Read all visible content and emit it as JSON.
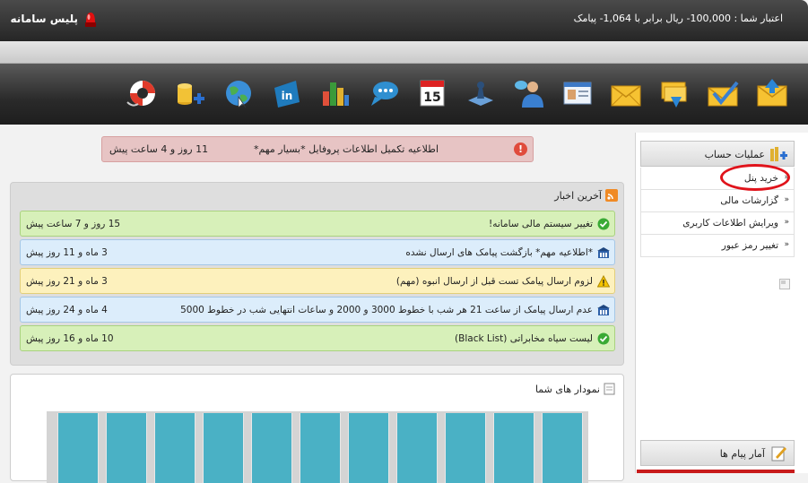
{
  "header": {
    "brand": "پلیس سامانه",
    "credit": "اعتبار شما : 100,000- ریال برابر با 1,064- پیامک"
  },
  "toolbar": {
    "icons": [
      "envelope-up-icon",
      "envelope-check-icon",
      "envelope-stack-icon",
      "envelope-open-icon",
      "id-card-icon",
      "contacts-icon",
      "chess-piece-icon",
      "calendar-icon",
      "chat-icon",
      "bar-chart-icon",
      "linkedin-icon",
      "globe-icon",
      "coins-add-icon",
      "lifebuoy-icon"
    ],
    "calendar_day": "15"
  },
  "alert": {
    "message": "اطلاعیه تکمیل اطلاعات پروفایل *بسیار مهم*",
    "time": "11 روز و 4 ساعت پیش"
  },
  "news": {
    "title": "آخرین اخبار",
    "items": [
      {
        "type": "green",
        "icon": "check",
        "text": "تغییر سیستم مالی سامانه!",
        "time": "15 روز و 7 ساعت پیش"
      },
      {
        "type": "blue",
        "icon": "info",
        "text": "*اطلاعیه مهم* بازگشت پیامک های ارسال نشده",
        "time": "3 ماه و 11 روز پیش"
      },
      {
        "type": "yellow",
        "icon": "warning",
        "text": "لزوم ارسال پیامک تست قبل از ارسال انبوه (مهم)",
        "time": "3 ماه و 21 روز پیش"
      },
      {
        "type": "blue",
        "icon": "info",
        "text": "عدم ارسال پیامک از ساعت 21 هر شب با خطوط 3000 و 2000 و ساعات انتهایی شب در خطوط 5000",
        "time": "4 ماه و 24 روز پیش"
      },
      {
        "type": "green",
        "icon": "check",
        "text": "لیست سیاه مخابراتی (Black List)",
        "time": "10 ماه و 16 روز پیش"
      }
    ]
  },
  "chart": {
    "title": "نمودار های شما"
  },
  "sidebar": {
    "title": "عملیات حساب",
    "items": [
      {
        "label": "خرید پنل"
      },
      {
        "label": "گزارشات مالی"
      },
      {
        "label": "ویرایش اطلاعات کاربری"
      },
      {
        "label": "تغییر رمز عبور"
      }
    ],
    "stats_title": "آمار پیام ها"
  },
  "colors": {
    "accent_bar": "#4ab1c5",
    "alert_bg": "#e7c4c4",
    "highlight_ring": "#e0131b"
  }
}
